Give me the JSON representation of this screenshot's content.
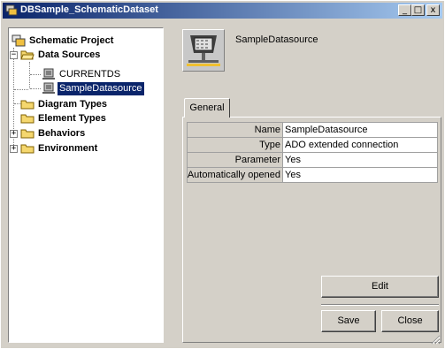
{
  "window": {
    "title": "DBSample_SchematicDataset",
    "minimize_glyph": "_",
    "maximize_glyph": "□",
    "close_glyph": "x"
  },
  "tree": {
    "items": [
      {
        "label": "Schematic Project",
        "icon": "project-icon"
      },
      {
        "label": "Data Sources",
        "icon": "folder-open-icon",
        "expander": "−"
      },
      {
        "label": "CURRENTDS",
        "icon": "datasource-icon"
      },
      {
        "label": "SampleDatasource",
        "icon": "datasource-icon"
      },
      {
        "label": "Diagram Types",
        "icon": "folder-icon"
      },
      {
        "label": "Element Types",
        "icon": "folder-icon"
      },
      {
        "label": "Behaviors",
        "icon": "folder-icon",
        "expander": "+"
      },
      {
        "label": "Environment",
        "icon": "folder-icon",
        "expander": "+"
      }
    ]
  },
  "header": {
    "title": "SampleDatasource",
    "icon": "datasource-large-icon"
  },
  "tabs": [
    {
      "label": "General"
    }
  ],
  "properties": [
    {
      "key": "Name",
      "value": "SampleDatasource"
    },
    {
      "key": "Type",
      "value": "ADO extended connection"
    },
    {
      "key": "Parameter",
      "value": "Yes"
    },
    {
      "key": "Automatically opened",
      "value": "Yes"
    }
  ],
  "buttons": {
    "edit": "Edit",
    "save": "Save",
    "close": "Close"
  }
}
